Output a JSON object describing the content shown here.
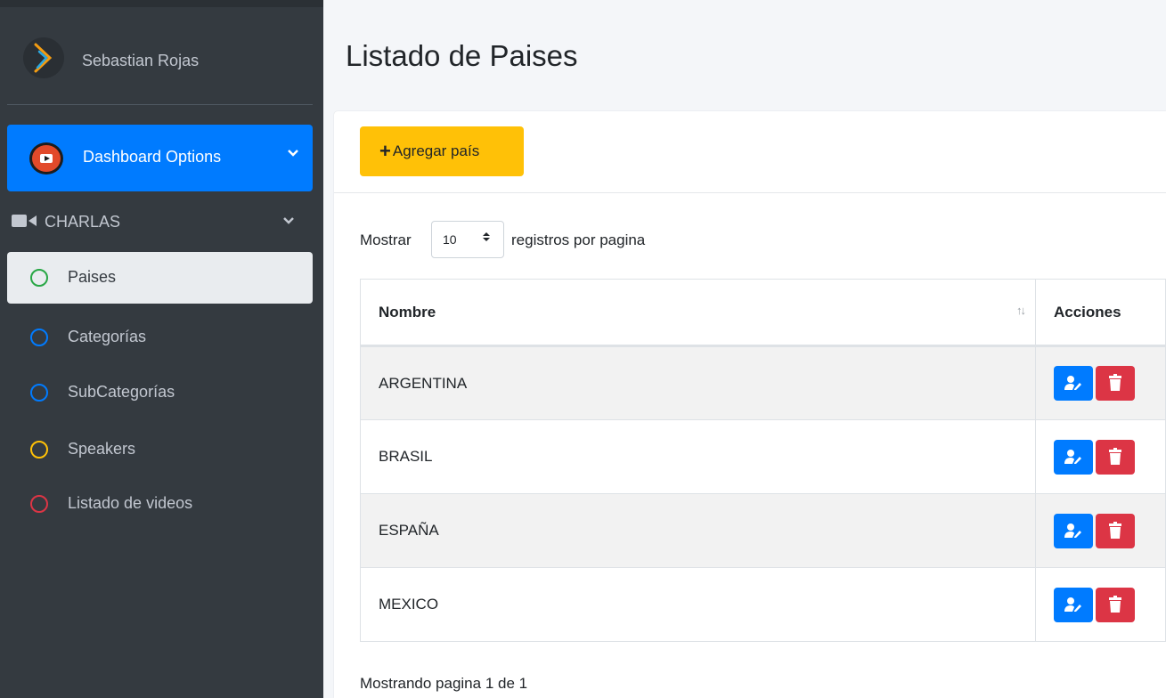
{
  "user": {
    "name": "Sebastian Rojas"
  },
  "nav": {
    "dashboard": "Dashboard Options",
    "charlas": "CHARLAS",
    "items": [
      {
        "label": "Paises",
        "color": "#28a745"
      },
      {
        "label": "Categorías",
        "color": "#007bff"
      },
      {
        "label": "SubCategorías",
        "color": "#007bff"
      },
      {
        "label": "Speakers",
        "color": "#ffc107"
      },
      {
        "label": "Listado de videos",
        "color": "#dc3545"
      }
    ]
  },
  "page": {
    "title": "Listado de Paises"
  },
  "toolbar": {
    "add_label": "Agregar país"
  },
  "table_controls": {
    "show_prefix": "Mostrar",
    "page_size": "10",
    "show_suffix": "registros por pagina"
  },
  "table": {
    "headers": {
      "name": "Nombre",
      "actions": "Acciones"
    },
    "rows": [
      {
        "name": "ARGENTINA"
      },
      {
        "name": "BRASIL"
      },
      {
        "name": "ESPAÑA"
      },
      {
        "name": "MEXICO"
      }
    ]
  },
  "pagination": {
    "info": "Mostrando pagina 1 de 1"
  },
  "colors": {
    "primary": "#007bff",
    "warning": "#ffc107",
    "danger": "#dc3545",
    "sidebar": "#343a40"
  }
}
